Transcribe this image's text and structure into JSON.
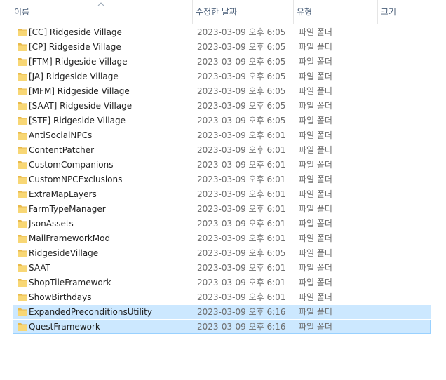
{
  "columns": {
    "name": "이름",
    "date": "수정한 날짜",
    "type": "유형",
    "size": "크기"
  },
  "files": [
    {
      "name": "[CC] Ridgeside Village",
      "date": "2023-03-09 오후 6:05",
      "type": "파일 폴더",
      "selected": false
    },
    {
      "name": "[CP] Ridgeside Village",
      "date": "2023-03-09 오후 6:05",
      "type": "파일 폴더",
      "selected": false
    },
    {
      "name": "[FTM] Ridgeside Village",
      "date": "2023-03-09 오후 6:05",
      "type": "파일 폴더",
      "selected": false
    },
    {
      "name": "[JA] Ridgeside Village",
      "date": "2023-03-09 오후 6:05",
      "type": "파일 폴더",
      "selected": false
    },
    {
      "name": "[MFM] Ridgeside Village",
      "date": "2023-03-09 오후 6:05",
      "type": "파일 폴더",
      "selected": false
    },
    {
      "name": "[SAAT] Ridgeside Village",
      "date": "2023-03-09 오후 6:05",
      "type": "파일 폴더",
      "selected": false
    },
    {
      "name": "[STF] Ridgeside Village",
      "date": "2023-03-09 오후 6:05",
      "type": "파일 폴더",
      "selected": false
    },
    {
      "name": "AntiSocialNPCs",
      "date": "2023-03-09 오후 6:01",
      "type": "파일 폴더",
      "selected": false
    },
    {
      "name": "ContentPatcher",
      "date": "2023-03-09 오후 6:01",
      "type": "파일 폴더",
      "selected": false
    },
    {
      "name": "CustomCompanions",
      "date": "2023-03-09 오후 6:01",
      "type": "파일 폴더",
      "selected": false
    },
    {
      "name": "CustomNPCExclusions",
      "date": "2023-03-09 오후 6:01",
      "type": "파일 폴더",
      "selected": false
    },
    {
      "name": "ExtraMapLayers",
      "date": "2023-03-09 오후 6:01",
      "type": "파일 폴더",
      "selected": false
    },
    {
      "name": "FarmTypeManager",
      "date": "2023-03-09 오후 6:01",
      "type": "파일 폴더",
      "selected": false
    },
    {
      "name": "JsonAssets",
      "date": "2023-03-09 오후 6:01",
      "type": "파일 폴더",
      "selected": false
    },
    {
      "name": "MailFrameworkMod",
      "date": "2023-03-09 오후 6:01",
      "type": "파일 폴더",
      "selected": false
    },
    {
      "name": "RidgesideVillage",
      "date": "2023-03-09 오후 6:05",
      "type": "파일 폴더",
      "selected": false
    },
    {
      "name": "SAAT",
      "date": "2023-03-09 오후 6:01",
      "type": "파일 폴더",
      "selected": false
    },
    {
      "name": "ShopTileFramework",
      "date": "2023-03-09 오후 6:01",
      "type": "파일 폴더",
      "selected": false
    },
    {
      "name": "ShowBirthdays",
      "date": "2023-03-09 오후 6:01",
      "type": "파일 폴더",
      "selected": false
    },
    {
      "name": "ExpandedPreconditionsUtility",
      "date": "2023-03-09 오후 6:16",
      "type": "파일 폴더",
      "selected": true
    },
    {
      "name": "QuestFramework",
      "date": "2023-03-09 오후 6:16",
      "type": "파일 폴더",
      "selected": true
    }
  ],
  "colors": {
    "selection_bg": "#cce8ff",
    "selection_border": "#99d1ff",
    "folder": "#f8d775",
    "header_text": "#4c607a"
  }
}
